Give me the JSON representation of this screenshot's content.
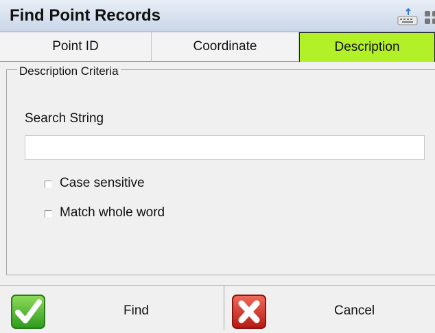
{
  "window": {
    "title": "Find Point Records",
    "icons": [
      "keyboard-icon",
      "options-icon"
    ]
  },
  "tabs": [
    {
      "label": "Point ID",
      "active": false
    },
    {
      "label": "Coordinate",
      "active": false
    },
    {
      "label": "Description",
      "active": true
    }
  ],
  "criteria": {
    "legend": "Description Criteria",
    "search_label": "Search String",
    "search_value": "",
    "case_sensitive": {
      "label": "Case sensitive",
      "checked": false
    },
    "match_whole_word": {
      "label": "Match whole word",
      "checked": false
    }
  },
  "buttons": {
    "find_label": "Find",
    "cancel_label": "Cancel"
  },
  "colors": {
    "active_tab": "#b2f027",
    "title_bar": "#c9d6e8"
  }
}
